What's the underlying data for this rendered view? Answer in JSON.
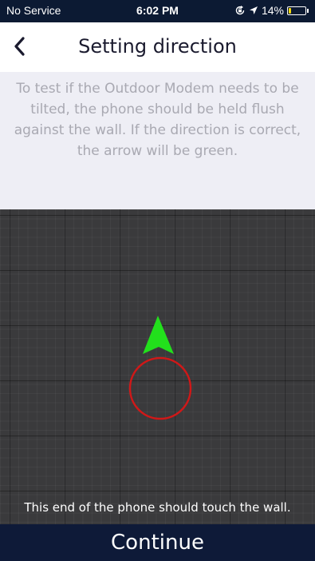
{
  "status_bar": {
    "carrier": "No Service",
    "time": "6:02 PM",
    "battery_percent": "14%",
    "battery_level": 0.14,
    "icons": [
      "orientation-lock-icon",
      "location-arrow-icon",
      "battery-icon"
    ]
  },
  "nav": {
    "back_icon": "chevron-left-icon",
    "title": "Setting direction"
  },
  "instructions": "To test if the Outdoor Modem needs to be tilted, the phone should be held flush against the wall. If the direction is correct, the arrow will be green.",
  "indicator": {
    "arrow_color": "#22e01c",
    "target_ring_color": "#d01818"
  },
  "hint": "This end of the phone should touch the wall.",
  "continue_label": "Continue"
}
